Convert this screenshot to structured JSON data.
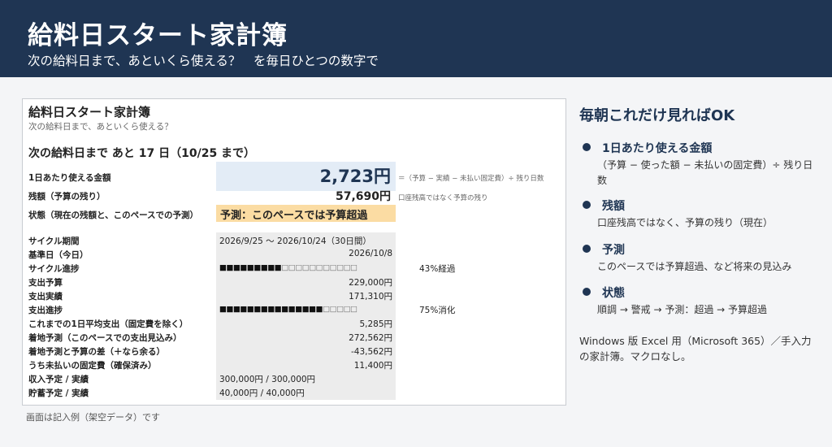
{
  "banner": {
    "title": "給料日スタート家計簿",
    "subtitle": "次の給料日まで、あといくら使える？　を毎日ひとつの数字で"
  },
  "sheet": {
    "title": "給料日スタート家計簿",
    "subtitle": "次の給料日まで、あといくら使える？",
    "countdown": "次の給料日まで あと 17 日（10/25 まで）",
    "daily_label": "1日あたり使える金額",
    "daily_value": "2,723円",
    "daily_note": "＝（予算 − 実績 − 未払い固定費）÷ 残り日数",
    "remaining_label": "残額（予算の残り）",
    "remaining_value": "57,690円",
    "remaining_note": "口座残高ではなく予算の残り",
    "status_label": "状態（現在の残額と、このペースでの予測）",
    "status_value": "予測：このペースでは予算超過",
    "rows": {
      "cycle_period": {
        "label": "サイクル期間",
        "value": "2026/9/25 〜 2026/10/24（30日間）"
      },
      "base_date": {
        "label": "基準日（今日）",
        "value": "2026/10/8"
      },
      "cycle_progress": {
        "label": "サイクル進捗",
        "filled": "■■■■■■■■■",
        "empty": "□□□□□□□□□□□",
        "pct": "43%経過",
        "fraction": 0.43
      },
      "budget": {
        "label": "支出予算",
        "value": "229,000円"
      },
      "actual": {
        "label": "支出実績",
        "value": "171,310円"
      },
      "spend_progress": {
        "label": "支出進捗",
        "filled": "■■■■■■■■■■■■■■■",
        "empty": "□□□□□",
        "pct": "75%消化",
        "fraction": 0.75
      },
      "avg_daily": {
        "label": "これまでの1日平均支出（固定費を除く）",
        "value": "5,285円"
      },
      "forecast": {
        "label": "着地予測（このペースでの支出見込み）",
        "value": "272,562円"
      },
      "forecast_diff": {
        "label": "着地予測と予算の差（＋なら余る）",
        "value": "-43,562円"
      },
      "unpaid_fixed": {
        "label": "うち未払いの固定費（確保済み）",
        "value": "11,400円"
      },
      "income": {
        "label": "収入予定 / 実績",
        "value": "300,000円 / 300,000円"
      },
      "savings": {
        "label": "貯蓄予定 / 実績",
        "value": "40,000円 / 40,000円"
      }
    }
  },
  "caption": "画面は記入例（架空データ）です",
  "side": {
    "heading": "毎朝これだけ見ればOK",
    "items": [
      {
        "title": "1日あたり使える金額",
        "desc": "（予算 − 使った額 − 未払いの固定費）÷ 残り日数"
      },
      {
        "title": "残額",
        "desc": "口座残高ではなく、予算の残り（現在）"
      },
      {
        "title": "予測",
        "desc": "このペースでは予算超過、など将来の見込み"
      },
      {
        "title": "状態",
        "desc": "順調 → 警戒 → 予測：超過 → 予算超過"
      }
    ],
    "footer": "Windows 版 Excel 用（Microsoft 365）／手入力の家計簿。マクロなし。"
  },
  "colors": {
    "banner": "#1f3553",
    "kpi_fill": "#e3ecf6",
    "status_fill": "#fbdca3",
    "detail_fill": "#ececec"
  }
}
